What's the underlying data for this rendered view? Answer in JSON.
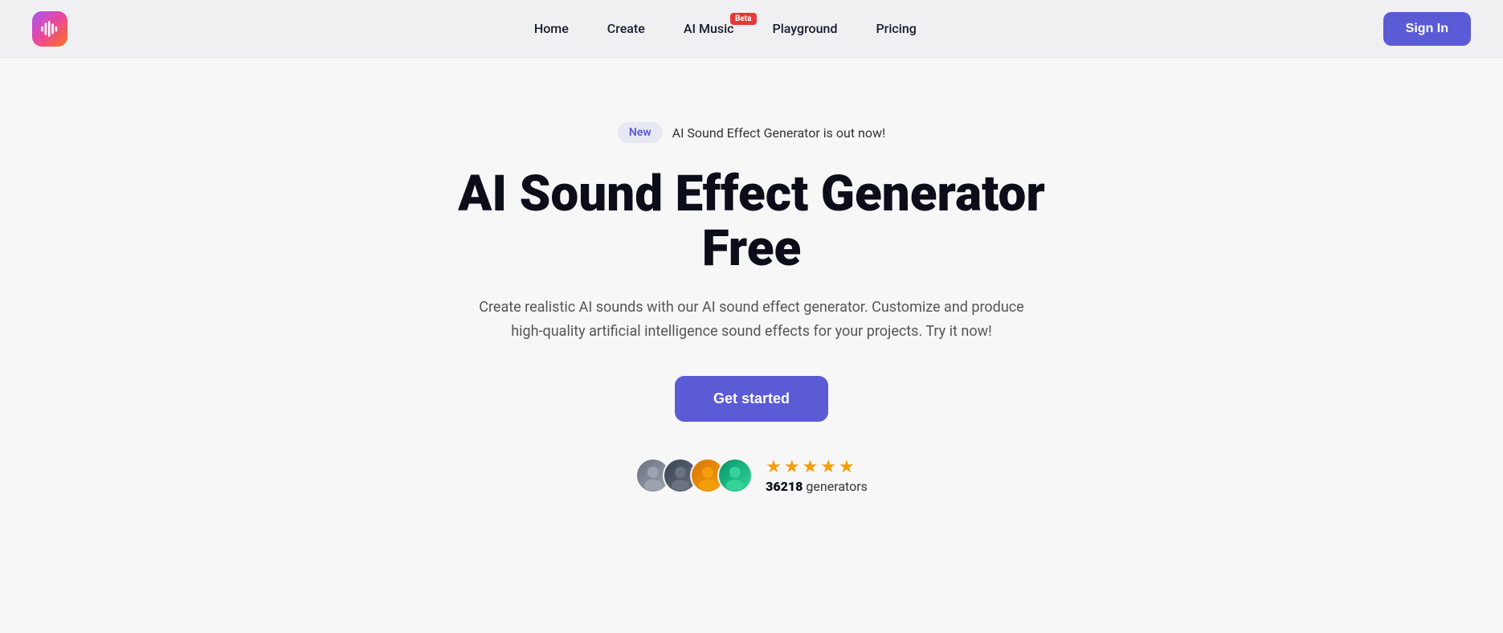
{
  "navbar": {
    "logo_alt": "AI Sound App Logo",
    "links": [
      {
        "id": "home",
        "label": "Home"
      },
      {
        "id": "create",
        "label": "Create"
      },
      {
        "id": "ai-music",
        "label": "AI Music",
        "badge": "Beta"
      },
      {
        "id": "playground",
        "label": "Playground"
      },
      {
        "id": "pricing",
        "label": "Pricing"
      }
    ],
    "sign_in_label": "Sign In"
  },
  "hero": {
    "badge_label": "New",
    "badge_text": "AI Sound Effect Generator is out now!",
    "title": "AI Sound Effect Generator Free",
    "subtitle": "Create realistic AI sounds with our AI sound effect generator. Customize and produce high-quality artificial intelligence sound effects for your projects. Try it now!",
    "cta_label": "Get started",
    "social": {
      "count": "36218",
      "count_suffix": " generators",
      "stars": 5
    }
  }
}
